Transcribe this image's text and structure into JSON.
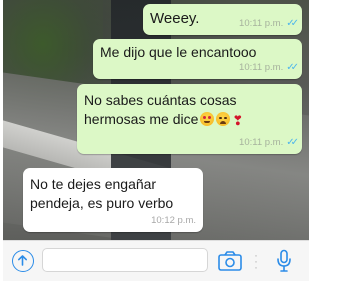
{
  "colors": {
    "outgoing_bubble": "#dcf8c6",
    "incoming_bubble": "#ffffff",
    "read_ticks": "#4fb6ec",
    "accent": "#2b8ce8"
  },
  "messages": [
    {
      "text": "Weeey.",
      "time": "10:11 p.m.",
      "direction": "outgoing",
      "ticks": "double-read"
    },
    {
      "text": "Me dijo que le encantooo",
      "time": "10:11 p.m.",
      "direction": "outgoing",
      "ticks": "double-read"
    },
    {
      "line1": "No sabes cuántas cosas",
      "line2": "hermosas me dice",
      "emojis": [
        "heart-eyes-emoji",
        "weary-face-emoji",
        "heart-exclamation-emoji"
      ],
      "time": "10:11 p.m.",
      "direction": "outgoing",
      "ticks": "double-read"
    },
    {
      "line1": "No te dejes engañar",
      "line2": "pendeja, es puro verbo",
      "time": "10:12 p.m.",
      "direction": "incoming"
    }
  ],
  "input_bar": {
    "placeholder": "",
    "value": "",
    "icons": [
      "upload-arrow-icon",
      "camera-icon",
      "more-dots-icon",
      "microphone-icon"
    ]
  }
}
